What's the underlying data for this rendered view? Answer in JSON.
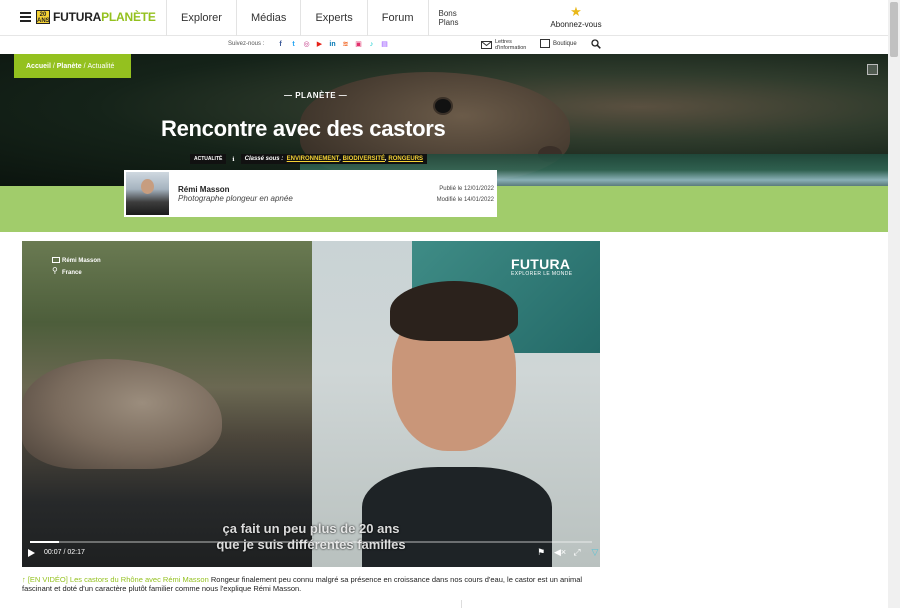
{
  "logo": {
    "badge": "20 ANS",
    "part1": "FUTURA",
    "part2": "PLANÈTE"
  },
  "nav": {
    "items": [
      "Explorer",
      "Médias",
      "Experts",
      "Forum"
    ],
    "bons_plans": "Bons Plans",
    "subscribe": "Abonnez-vous"
  },
  "subbar": {
    "follow": "Suivez-nous :",
    "socials": [
      "f",
      "t",
      "ig",
      "yt",
      "in",
      "rss",
      "fl",
      "tt",
      "tw"
    ],
    "newsletter": "Lettres d'information",
    "shop": "Boutique"
  },
  "hero": {
    "breadcrumb": {
      "home": "Accueil",
      "section": "Planète",
      "current": "Actualité"
    },
    "kicker": "— PLANÈTE —",
    "title": "Rencontre avec des castors",
    "tag_type": "ACTUALITÉ",
    "classified_label": "Classé sous :",
    "keywords": [
      "ENVIRONNEMENT",
      "BIODIVERSITÉ",
      "RONGEURS"
    ]
  },
  "author": {
    "name": "Rémi Masson",
    "role": "Photographe plongeur en apnée",
    "published": "Publié le 12/01/2022",
    "modified": "Modifié le 14/01/2022"
  },
  "video": {
    "location_name": "Rémi Masson",
    "location_country": "France",
    "watermark_big": "FUTURA",
    "watermark_small": "EXPLORER LE MONDE",
    "subtitle_line1": "ça fait un peu plus de 20 ans",
    "subtitle_line2": "que je suis différentes familles",
    "time": "00:07 / 02:17",
    "progress": 0.051
  },
  "caption": {
    "link": "[EN VIDÉO] Les castors du Rhône avec Rémi Masson",
    "text": "Rongeur finalement peu connu malgré sa présence en croissance dans nos cours d'eau, le castor est un animal fascinant et doté d'un caractère plutôt familier comme nous l'explique Rémi Masson."
  },
  "colors": {
    "brand_green": "#94c11f",
    "band_green": "#a1cc6b",
    "keyword_yellow": "#f4d235"
  }
}
